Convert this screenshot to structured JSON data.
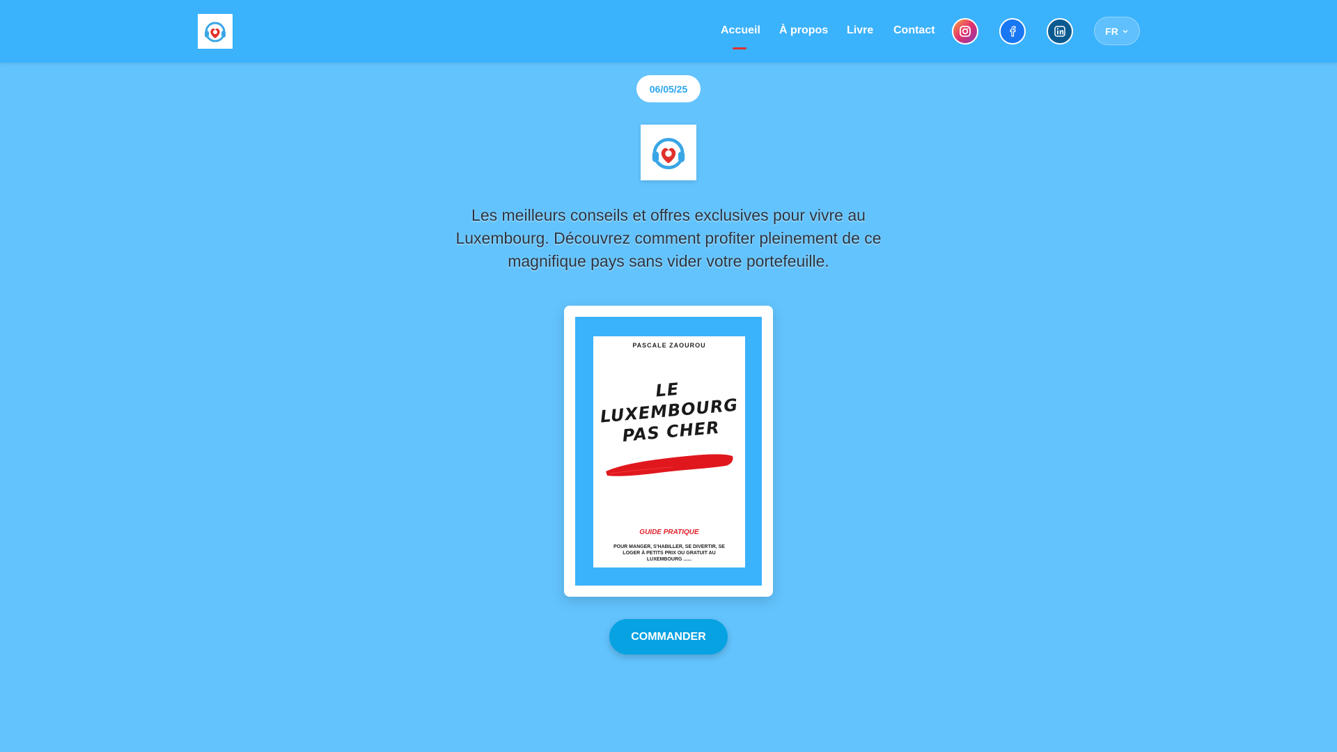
{
  "header": {
    "logo_icon": "headset-heart-logo-icon",
    "nav": [
      {
        "label": "Accueil",
        "active": true
      },
      {
        "label": "À propos"
      },
      {
        "label": "Livre"
      },
      {
        "label": "Contact"
      }
    ],
    "social": [
      {
        "icon": "instagram-icon",
        "color": "#e1306c"
      },
      {
        "icon": "facebook-icon",
        "color": "#1877f2"
      },
      {
        "icon": "linkedin-icon",
        "color": "#0a66c2"
      }
    ],
    "language": "FR",
    "colors": {
      "bar": "#3bb2fc",
      "active_underline": "#e0312c"
    }
  },
  "main": {
    "date": "06/05/25",
    "tagline": "Les meilleurs conseils et offres exclusives pour vivre au Luxembourg. Découvrez comment profiter pleinement de ce magnifique pays sans vider votre portefeuille.",
    "book": {
      "author": "PASCALE ZAOUROU",
      "title_line1": "LE",
      "title_line2": "LUXEMBOURG",
      "title_line3": "PAS CHER",
      "subtitle": "GUIDE PRATIQUE",
      "description": "POUR MANGER, S'HABILLER, SE DIVERTIR, SE LOGER À PETITS PRIX OU GRATUIT AU LUXEMBOURG ......"
    },
    "order_button": "COMMANDER",
    "background_color": "#63c3fd"
  }
}
